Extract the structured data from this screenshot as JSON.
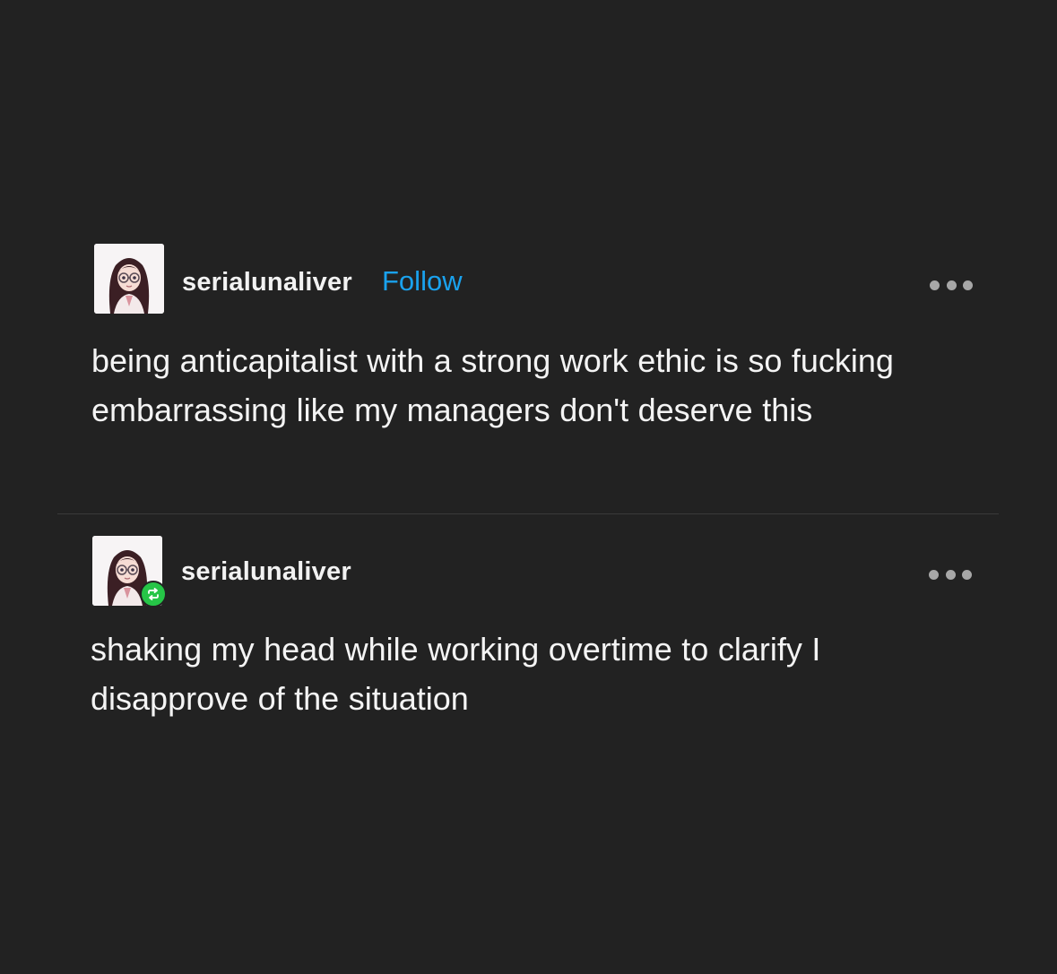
{
  "posts": [
    {
      "username": "serialunaliver",
      "follow_label": "Follow",
      "body": "being anticapitalist with a strong work ethic is so fucking embarrassing like my managers don't deserve this"
    },
    {
      "username": "serialunaliver",
      "body": "shaking my head while working overtime to clarify I disapprove of the situation",
      "reblog_badge_icon": "reblog-icon"
    }
  ],
  "colors": {
    "background": "#222222",
    "text": "#f4f4f4",
    "follow": "#1aa2ee",
    "reblog_badge": "#26c547",
    "menu_dots": "#a7a7a7"
  }
}
